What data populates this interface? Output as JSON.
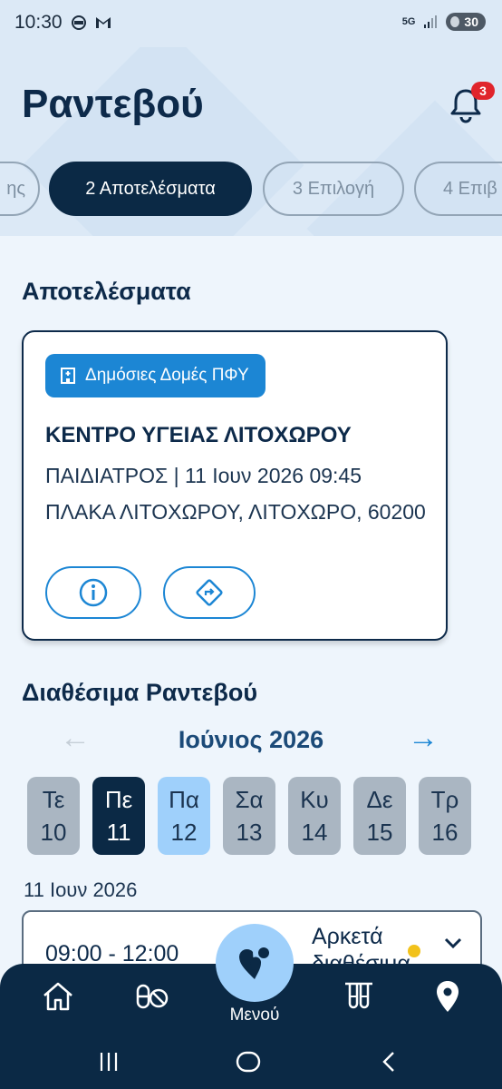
{
  "status": {
    "time": "10:30",
    "network": "5G",
    "battery": "30"
  },
  "header": {
    "title": "Ραντεβού",
    "notifications": "3"
  },
  "steps": [
    {
      "label": "ης"
    },
    {
      "label": "2 Αποτελέσματα"
    },
    {
      "label": "3 Επιλογή"
    },
    {
      "label": "4 Επιβ"
    }
  ],
  "results": {
    "heading": "Αποτελέσματα",
    "chip": "Δημόσιες Δομές ΠΦΥ",
    "name": "ΚΕΝΤΡΟ ΥΓΕΙΑΣ ΛΙΤΟΧΩΡΟΥ",
    "specialty_date": "ΠΑΙΔΙΑΤΡΟΣ | 11 Ιουν 2026 09:45",
    "address": "ΠΛΑΚΑ ΛΙΤΟΧΩΡΟΥ, ΛΙΤΟΧΩΡΟ, 60200"
  },
  "availability": {
    "heading": "Διαθέσιμα Ραντεβού",
    "month": "Ιούνιος 2026",
    "days": [
      {
        "dow": "Τε",
        "num": "10"
      },
      {
        "dow": "Πε",
        "num": "11"
      },
      {
        "dow": "Πα",
        "num": "12"
      },
      {
        "dow": "Σα",
        "num": "13"
      },
      {
        "dow": "Κυ",
        "num": "14"
      },
      {
        "dow": "Δε",
        "num": "15"
      },
      {
        "dow": "Τρ",
        "num": "16"
      }
    ],
    "selected_date": "11 Ιουν 2026",
    "slot_time": "09:00 - 12:00",
    "slot_status_line1": "Αρκετά",
    "slot_status_line2": "διαθέσιμα"
  },
  "nav": {
    "menu_label": "Μενού"
  },
  "colors": {
    "primary": "#0b2945",
    "accent": "#1c86d4",
    "light": "#9fd0fb",
    "badge": "#e0242b"
  }
}
